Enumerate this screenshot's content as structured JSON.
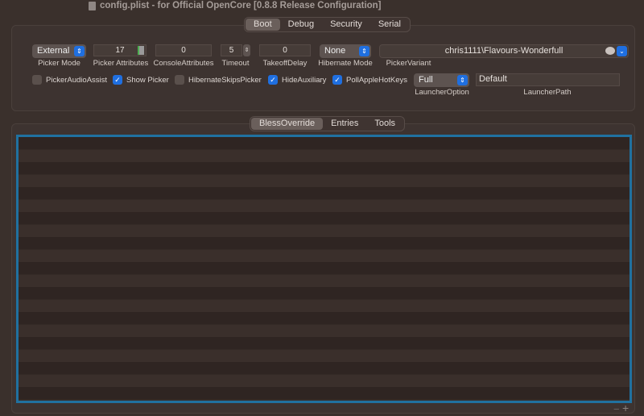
{
  "window": {
    "title": "config.plist - for Official OpenCore [0.8.8 Release Configuration]"
  },
  "top_tabs": [
    "Boot",
    "Debug",
    "Security",
    "Serial"
  ],
  "boot": {
    "picker_mode": {
      "value": "External",
      "label": "Picker Mode"
    },
    "picker_attributes": {
      "value": "17",
      "label": "Picker Attributes"
    },
    "console_attributes": {
      "value": "0",
      "label": "ConsoleAttributes"
    },
    "timeout": {
      "value": "5",
      "label": "Timeout"
    },
    "takeoff_delay": {
      "value": "0",
      "label": "TakeoffDelay"
    },
    "hibernate_mode": {
      "value": "None",
      "label": "Hibernate Mode"
    },
    "picker_variant": {
      "value": "chris1111\\Flavours-Wonderfull",
      "label": "PickerVariant"
    },
    "checkboxes": [
      {
        "label": "PickerAudioAssist",
        "checked": false
      },
      {
        "label": "Show Picker",
        "checked": true
      },
      {
        "label": "HibernateSkipsPicker",
        "checked": false
      },
      {
        "label": "HideAuxiliary",
        "checked": true
      },
      {
        "label": "PollAppleHotKeys",
        "checked": true
      }
    ],
    "launcher_option": {
      "value": "Full",
      "label": "LauncherOption"
    },
    "launcher_path": {
      "value": "Default",
      "label": "LauncherPath"
    }
  },
  "sub_tabs": [
    "BlessOverride",
    "Entries",
    "Tools"
  ],
  "table_controls": {
    "remove": "−",
    "add": "+"
  }
}
